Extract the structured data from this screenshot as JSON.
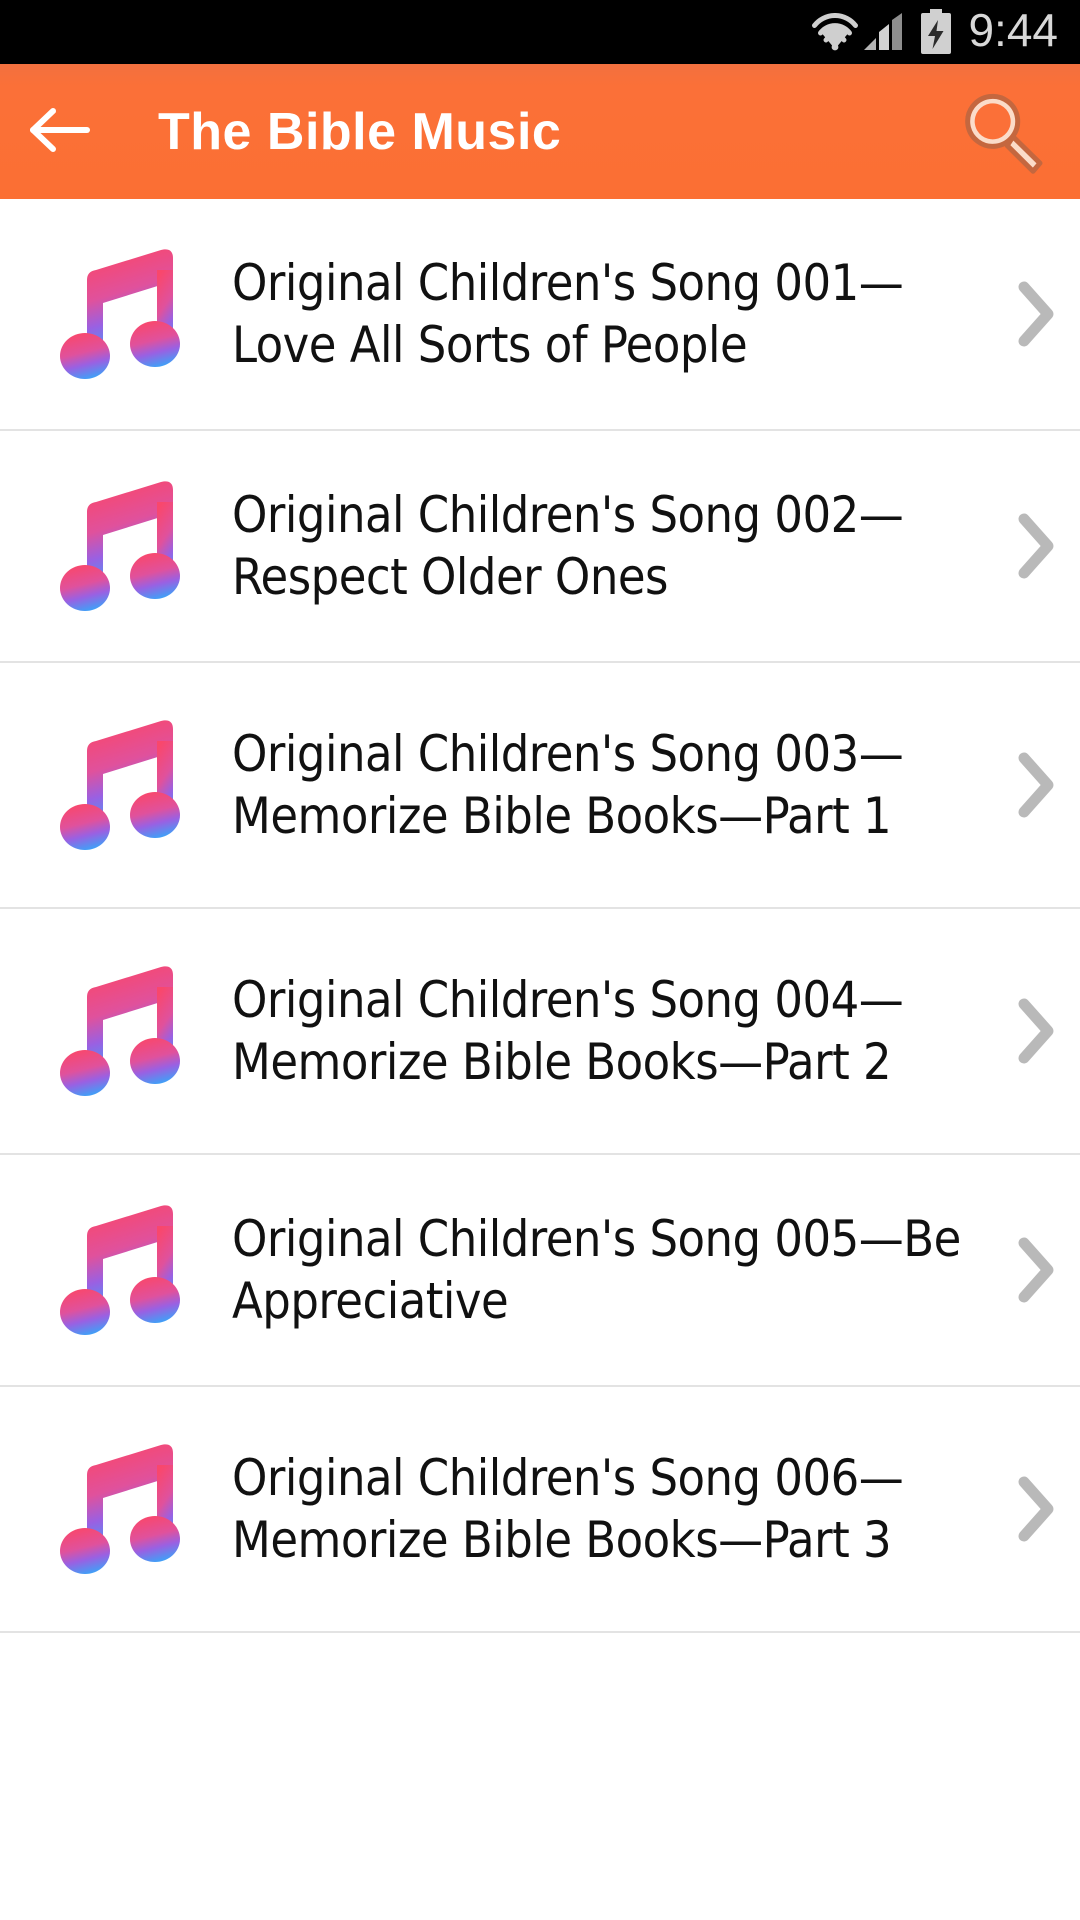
{
  "status_bar": {
    "time": "9:44",
    "icons": [
      "wifi-icon",
      "signal-icon",
      "battery-charging-icon"
    ],
    "background_color": "#000000",
    "icon_color": "#d0d0d0"
  },
  "app_bar": {
    "title": "The Bible Music",
    "back_label": "back-arrow-icon",
    "search_label": "search-icon",
    "background_color": "#fb7038",
    "title_color": "#ffffff",
    "search_icon_color": "#f9cdb6"
  },
  "list": {
    "item_icon": "music-note-icon",
    "chevron_icon": "chevron-right-icon",
    "icon_gradient": {
      "top": "#f9486a",
      "mid": "#a05ce0",
      "bottom": "#3fa2f7"
    },
    "divider_color": "#e3e3e3",
    "items": [
      {
        "title": "Original Children's Song 001—Love All Sorts of People",
        "lines": 2
      },
      {
        "title": "Original Children's Song 002—Respect Older Ones",
        "lines": 2
      },
      {
        "title": "Original Children's Song 003—Memorize Bible Books—Part 1",
        "lines": 3
      },
      {
        "title": "Original Children's Song 004—Memorize Bible Books—Part 2",
        "lines": 3
      },
      {
        "title": "Original Children's Song 005—Be Appreciative",
        "lines": 2
      },
      {
        "title": "Original Children's Song 006—Memorize Bible Books—Part 3",
        "lines": 3
      }
    ]
  }
}
